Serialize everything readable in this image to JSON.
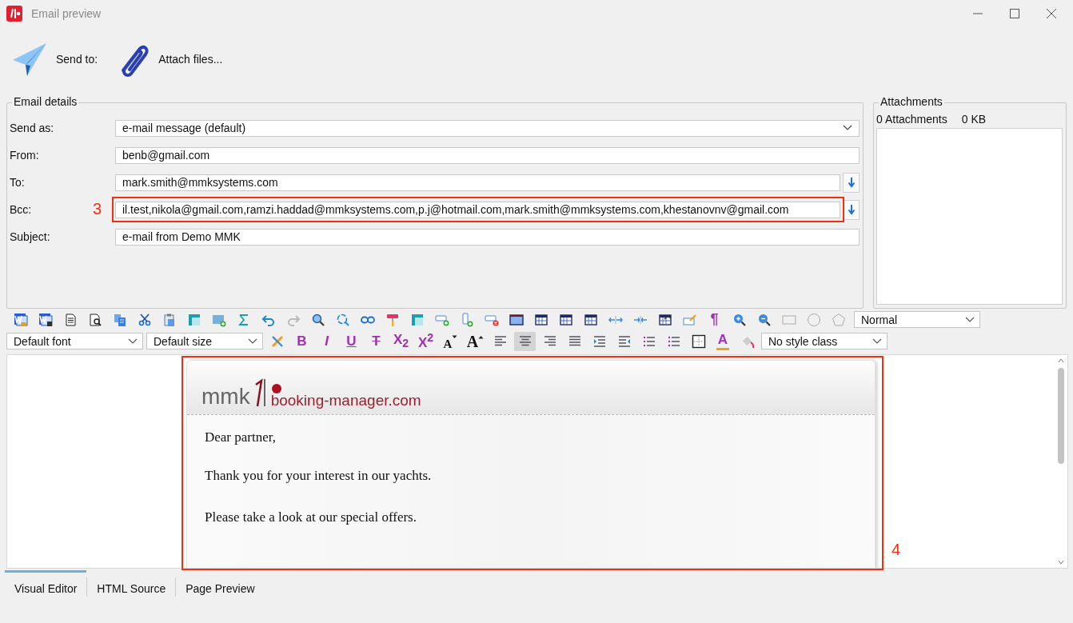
{
  "window": {
    "title": "Email preview"
  },
  "toolbar": [
    {
      "label": "Send to:"
    },
    {
      "label": "Attach files..."
    }
  ],
  "email_details": {
    "legend": "Email details",
    "fields": [
      {
        "kind": "select",
        "label": "Send as:",
        "value": "e-mail message (default)"
      },
      {
        "kind": "text",
        "label": "From:",
        "value": "benb@gmail.com"
      },
      {
        "kind": "lookup",
        "label": "To:",
        "value": "mark.smith@mmksystems.com"
      },
      {
        "kind": "lookup",
        "label": "Bcc:",
        "value": "il.test,nikola@gmail.com,ramzi.haddad@mmksystems.com,p.j@hotmail.com,mark.smith@mmksystems.com,khestanovnv@gmail.com",
        "annotation": "3"
      },
      {
        "kind": "text",
        "label": "Subject:",
        "value": "e-mail from Demo MMK"
      }
    ]
  },
  "attachments": {
    "legend": "Attachments",
    "count": "0 Attachments",
    "size": "0 KB"
  },
  "editor": {
    "pilcrow": "¶",
    "paragraph_style": "Normal",
    "font": "Default font",
    "size": "Default size",
    "format_glyphs": [
      "B",
      "I",
      "U",
      "T",
      "X$_{2}$",
      "X$^{2}$",
      "A",
      "A",
      "A"
    ],
    "align_buttons": [
      {
        "selected": false
      },
      {
        "selected": true
      },
      {
        "selected": false
      },
      {
        "selected": false
      }
    ],
    "style_class": "No style class"
  },
  "email_body": {
    "annotation": "4",
    "logo_left": "mmk",
    "logo_right": "booking-manager.com",
    "paragraphs": [
      "Dear partner,",
      "Thank you for your interest in our yachts.",
      "Please take a look at our special offers."
    ]
  },
  "tabs": [
    {
      "label": "Visual Editor",
      "selected": true
    },
    {
      "label": "HTML Source",
      "selected": false
    },
    {
      "label": "Page Preview",
      "selected": false
    }
  ]
}
